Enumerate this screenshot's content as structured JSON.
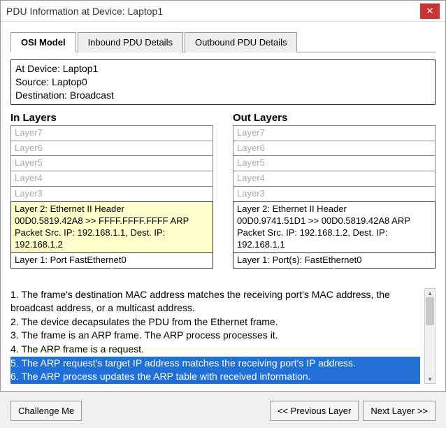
{
  "titlebar": {
    "title": "PDU Information at Device: Laptop1"
  },
  "tabs": {
    "osi": "OSI Model",
    "inbound": "Inbound PDU Details",
    "outbound": "Outbound PDU Details"
  },
  "info": {
    "device": "At Device: Laptop1",
    "source": "Source: Laptop0",
    "dest": "Destination: Broadcast"
  },
  "inlayers": {
    "title": "In Layers",
    "l7": "Layer7",
    "l6": "Layer6",
    "l5": "Layer5",
    "l4": "Layer4",
    "l3": "Layer3",
    "l2a": "Layer 2: Ethernet II Header",
    "l2b": "00D0.5819.42A8 >> FFFF.FFFF.FFFF ARP",
    "l2c": "Packet Src. IP: 192.168.1.1, Dest. IP:",
    "l2d": "192.168.1.2",
    "l1": "Layer 1: Port FastEthernet0"
  },
  "outlayers": {
    "title": "Out Layers",
    "l7": "Layer7",
    "l6": "Layer6",
    "l5": "Layer5",
    "l4": "Layer4",
    "l3": "Layer3",
    "l2a": "Layer 2: Ethernet II Header",
    "l2b": "00D0.9741.51D1 >> 00D0.5819.42A8 ARP",
    "l2c": "Packet Src. IP: 192.168.1.2, Dest. IP:",
    "l2d": "192.168.1.1",
    "l1": "Layer 1: Port(s): FastEthernet0"
  },
  "desc": {
    "l1": "1. The frame's destination MAC address matches the receiving port's MAC address, the broadcast address, or a multicast address.",
    "l2": "2. The device decapsulates the PDU from the Ethernet frame.",
    "l3": "3. The frame is an ARP frame. The ARP process processes it.",
    "l4": "4. The ARP frame is a request.",
    "l5": "5. The ARP request's target IP address matches the receiving port's IP address.",
    "l6": "6. The ARP process updates the ARP table with received information."
  },
  "buttons": {
    "challenge": "Challenge Me",
    "prev": "<< Previous Layer",
    "next": "Next Layer >>"
  }
}
